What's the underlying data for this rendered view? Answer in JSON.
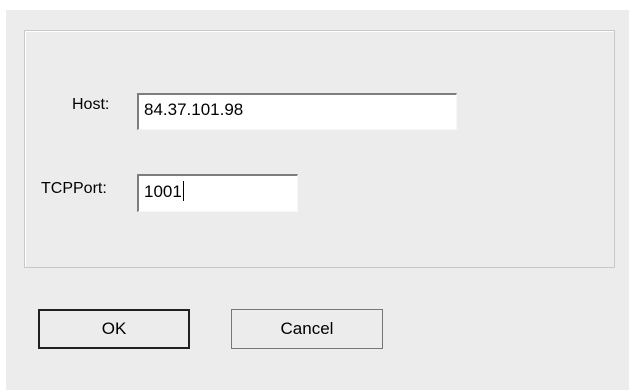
{
  "dialog": {
    "host_label": "Host:",
    "host_value": "84.37.101.98",
    "port_label": "TCPPort:",
    "port_value": "1001",
    "ok_label": "OK",
    "cancel_label": "Cancel"
  }
}
